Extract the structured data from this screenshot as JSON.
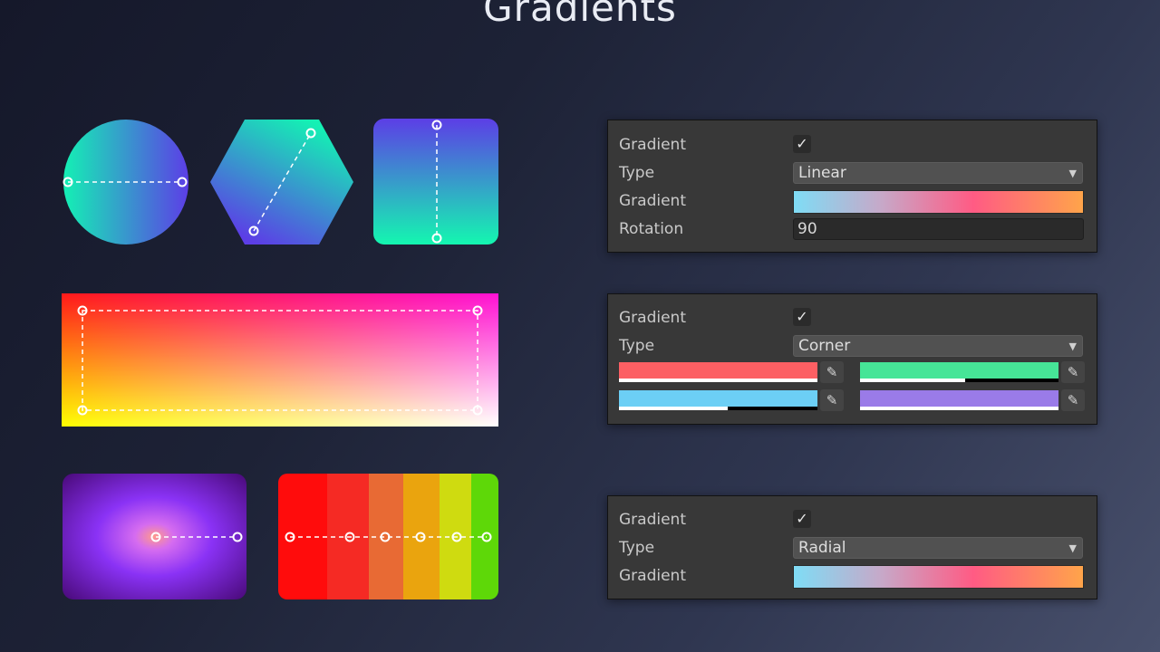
{
  "header": {
    "title": "Gradients"
  },
  "colors": {
    "teal": "#16f2b3",
    "violet": "#5b3de8",
    "red": "#ff1a1a",
    "magenta": "#ff12d4",
    "yellow": "#ffff00",
    "white": "#ffffff",
    "orange": "#ff9a42",
    "purple_dark": "#4a0a7a"
  },
  "panels": {
    "linear": {
      "gradient_label": "Gradient",
      "gradient_checked": true,
      "type_label": "Type",
      "type_value": "Linear",
      "ramp_label": "Gradient",
      "rotation_label": "Rotation",
      "rotation_value": "90"
    },
    "corner": {
      "gradient_label": "Gradient",
      "gradient_checked": true,
      "type_label": "Type",
      "type_value": "Corner",
      "corners": [
        {
          "color": "#fc5f63",
          "alpha": 1.0
        },
        {
          "color": "#46e597",
          "alpha": 0.53
        },
        {
          "color": "#6ccff5",
          "alpha": 0.55
        },
        {
          "color": "#9a7be8",
          "alpha": 1.0
        }
      ]
    },
    "radial": {
      "gradient_label": "Gradient",
      "gradient_checked": true,
      "type_label": "Type",
      "type_value": "Radial",
      "ramp_label": "Gradient"
    }
  },
  "icons": {
    "checkmark": "checkmark-icon",
    "dropdown": "chevron-down-icon",
    "eyedropper": "eyedropper-icon"
  }
}
